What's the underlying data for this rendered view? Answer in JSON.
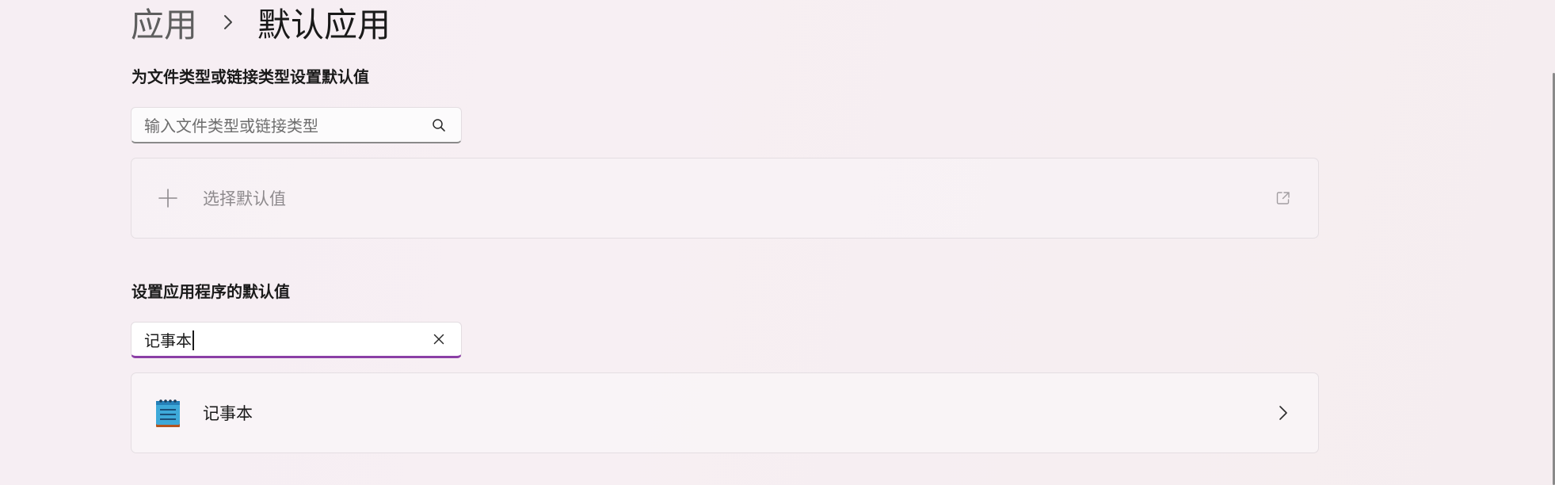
{
  "breadcrumb": {
    "parent": "应用",
    "separator_icon": "chevron-right-icon",
    "current": "默认应用"
  },
  "file_type_section": {
    "title": "为文件类型或链接类型设置默认值",
    "search": {
      "placeholder": "输入文件类型或链接类型",
      "value": "",
      "icon": "search-icon"
    },
    "choose_default": {
      "icon": "plus-icon",
      "label": "选择默认值",
      "trail_icon": "open-external-icon",
      "enabled": false
    }
  },
  "app_section": {
    "title": "设置应用程序的默认值",
    "search": {
      "value": "记事本",
      "icon": "clear-icon",
      "focused": true
    },
    "results": [
      {
        "name": "记事本",
        "icon": "notepad-icon",
        "trail_icon": "chevron-right-icon"
      }
    ]
  },
  "colors": {
    "accent": "#8b3fa6",
    "background": "#f6eef3",
    "card_border": "#e4dee2"
  }
}
